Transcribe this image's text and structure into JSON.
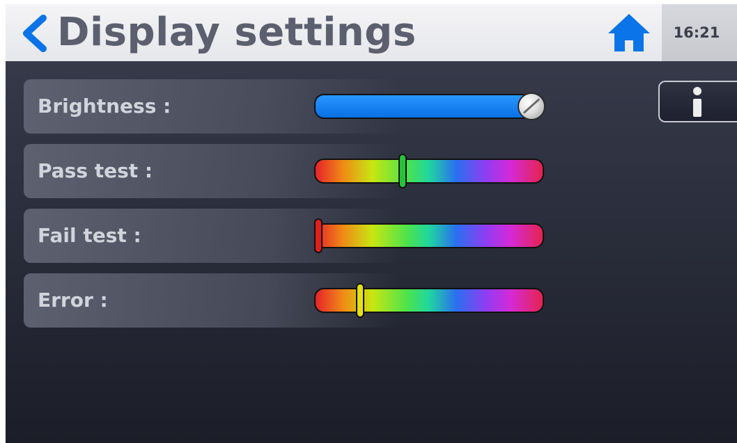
{
  "header": {
    "back_icon": "chevron-left-icon",
    "title": "Display settings",
    "home_icon": "home-icon",
    "time": "16:21"
  },
  "colors": {
    "accent_blue": "#0a74e8",
    "title_gray": "#5b5f6e",
    "label_light": "#d2d4dc"
  },
  "settings": [
    {
      "label": "Brightness :",
      "control": "slider",
      "value_fraction": 1.0,
      "track": "blue"
    },
    {
      "label": "Pass test :",
      "control": "color-hue-slider",
      "value_fraction": 0.38,
      "marker_color": "#27c23a"
    },
    {
      "label": "Fail test :",
      "control": "color-hue-slider",
      "value_fraction": 0.0,
      "marker_color": "#e0201e"
    },
    {
      "label": "Error :",
      "control": "color-hue-slider",
      "value_fraction": 0.19,
      "marker_color": "#e3e015"
    }
  ],
  "info_button": {
    "icon": "info-icon"
  }
}
